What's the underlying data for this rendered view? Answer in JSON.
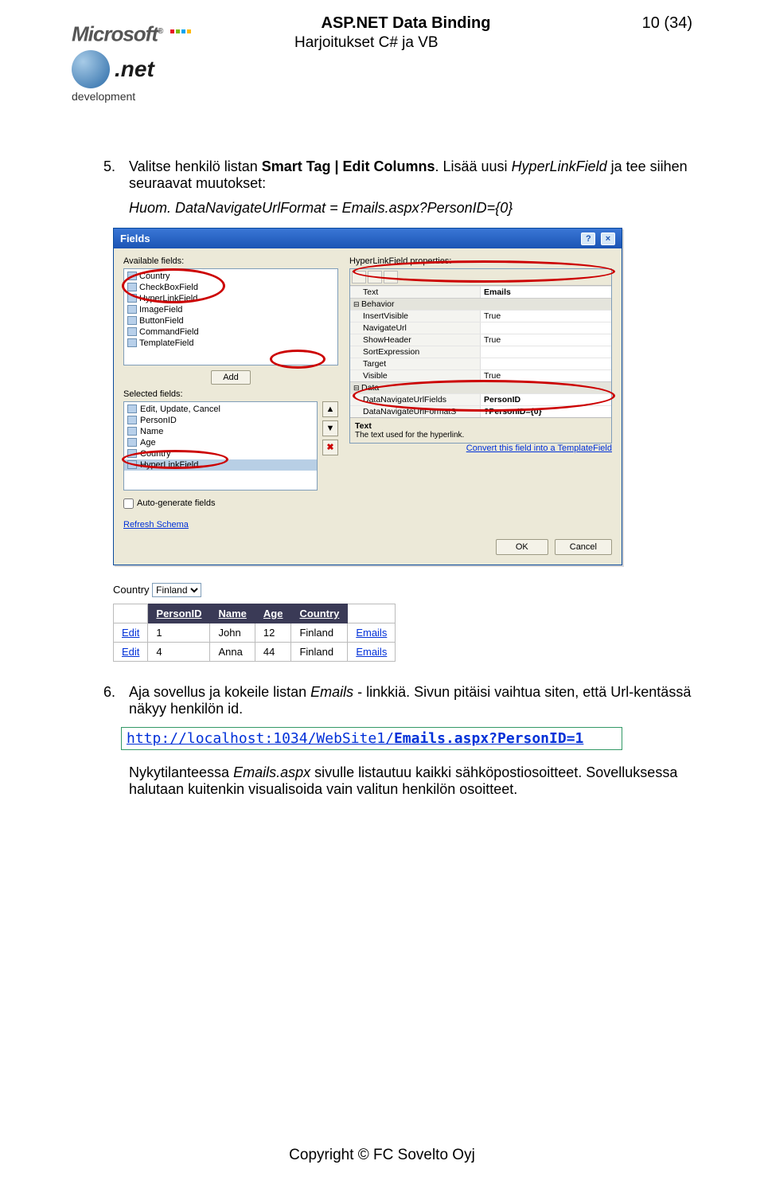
{
  "header": {
    "title": "ASP.NET Data Binding",
    "subtitle": "Harjoitukset C# ja VB",
    "page_label": "10 (34)",
    "logo": {
      "brand": "Microsoft",
      "product": ".net",
      "tagline": "development"
    }
  },
  "steps": {
    "s5": {
      "num": "5.",
      "pre": "Valitse henkilö listan ",
      "bold": "Smart Tag | Edit Columns",
      "post": ". Lisää uusi ",
      "italic": "HyperLinkField",
      "post2": " ja tee siihen seuraavat muutokset:",
      "formula": "Huom. DataNavigateUrlFormat = Emails.aspx?PersonID={0}"
    },
    "s6": {
      "num": "6.",
      "t1": "Aja sovellus ja kokeile listan ",
      "it1": "Emails",
      "t2": " - linkkiä. Sivun pitäisi vaihtua siten, että Url-kentässä näkyy henkilön id.",
      "url_plain": "http://localhost:1034/WebSite1/",
      "url_bold": "Emails.aspx?PersonID=1",
      "t3a": "Nykytilanteessa ",
      "it2": "Emails.aspx",
      "t3b": " sivulle listautuu kaikki sähköpostiosoitteet. Sovelluksessa halutaan kuitenkin visualisoida vain valitun henkilön osoitteet."
    }
  },
  "dialog": {
    "title": "Fields",
    "help": "?",
    "close": "×",
    "avail_lbl": "Available fields:",
    "avail": [
      "Country",
      "CheckBoxField",
      "HyperLinkField",
      "ImageField",
      "ButtonField",
      "CommandField",
      "TemplateField"
    ],
    "add_btn": "Add",
    "sel_lbl": "Selected fields:",
    "selected": [
      "Edit, Update, Cancel",
      "PersonID",
      "Name",
      "Age",
      "Country",
      "HyperLinkField"
    ],
    "autogen": "Auto-generate fields",
    "refresh": "Refresh Schema",
    "props_lbl": "HyperLinkField properties:",
    "props_text_row": {
      "k": "Text",
      "v": "Emails"
    },
    "cat_behavior": "Behavior",
    "behavior": [
      {
        "k": "InsertVisible",
        "v": "True"
      },
      {
        "k": "NavigateUrl",
        "v": ""
      },
      {
        "k": "ShowHeader",
        "v": "True"
      },
      {
        "k": "SortExpression",
        "v": ""
      },
      {
        "k": "Target",
        "v": ""
      },
      {
        "k": "Visible",
        "v": "True"
      }
    ],
    "cat_data": "Data",
    "data": [
      {
        "k": "DataNavigateUrlFields",
        "v": "PersonID"
      },
      {
        "k": "DataNavigateUrlFormatS",
        "v": "?PersonID={0}"
      }
    ],
    "propdesc_title": "Text",
    "propdesc_text": "The text used for the hyperlink.",
    "template_link": "Convert this field into a TemplateField",
    "ok": "OK",
    "cancel": "Cancel"
  },
  "preview": {
    "country_lbl": "Country",
    "country_val": "Finland",
    "cols": [
      "PersonID",
      "Name",
      "Age",
      "Country",
      ""
    ],
    "rows": [
      {
        "edit": "Edit",
        "id": "1",
        "name": "John",
        "age": "12",
        "country": "Finland",
        "link": "Emails"
      },
      {
        "edit": "Edit",
        "id": "4",
        "name": "Anna",
        "age": "44",
        "country": "Finland",
        "link": "Emails"
      }
    ]
  },
  "footer": {
    "copyright": "Copyright  ©  FC Sovelto Oyj"
  }
}
